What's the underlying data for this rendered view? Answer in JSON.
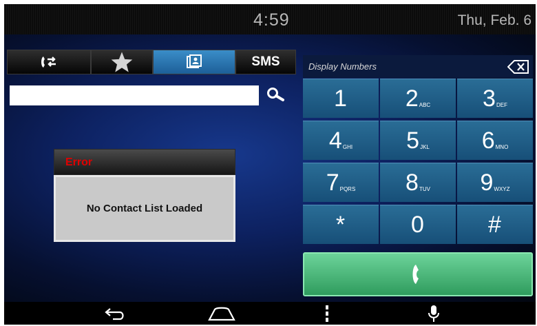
{
  "status_bar": {
    "time": "4:59",
    "date": "Thu, Feb. 6"
  },
  "tabs": [
    {
      "name": "recent-calls",
      "icon": "call-switch-icon"
    },
    {
      "name": "favorites",
      "icon": "star-icon"
    },
    {
      "name": "contacts",
      "icon": "contact-card-icon",
      "active": true
    },
    {
      "name": "sms",
      "label": "SMS"
    }
  ],
  "search": {
    "value": "",
    "icon": "search-icon"
  },
  "error_dialog": {
    "title": "Error",
    "message": "No Contact List Loaded"
  },
  "dialer": {
    "display_placeholder": "Display Numbers",
    "backspace_icon": "backspace-icon",
    "keys": [
      {
        "digit": "1",
        "letters": ""
      },
      {
        "digit": "2",
        "letters": "ABC"
      },
      {
        "digit": "3",
        "letters": "DEF"
      },
      {
        "digit": "4",
        "letters": "GHI"
      },
      {
        "digit": "5",
        "letters": "JKL"
      },
      {
        "digit": "6",
        "letters": "MNO"
      },
      {
        "digit": "7",
        "letters": "PQRS"
      },
      {
        "digit": "8",
        "letters": "TUV"
      },
      {
        "digit": "9",
        "letters": "WXYZ"
      },
      {
        "digit": "*",
        "letters": ""
      },
      {
        "digit": "0",
        "letters": ""
      },
      {
        "digit": "#",
        "letters": ""
      }
    ],
    "call_icon": "phone-handset-icon"
  },
  "nav_bar": {
    "items": [
      "back-icon",
      "home-icon",
      "menu-icon",
      "microphone-icon"
    ]
  },
  "colors": {
    "accent": "#2a6d96",
    "call_button": "#3fae6e",
    "error_title": "#e00000"
  }
}
